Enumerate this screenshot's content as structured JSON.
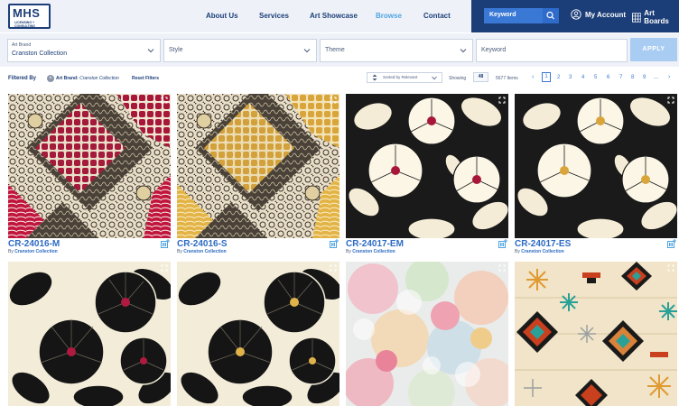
{
  "header": {
    "logo_text": "MHS",
    "logo_sub": "LICENSING + CONSULTING",
    "nav": [
      "About Us",
      "Services",
      "Art Showcase",
      "Browse",
      "Contact"
    ],
    "active_nav": "Browse",
    "keyword_label": "Keyword",
    "account_label": "My Account",
    "boards_label": "Art Boards"
  },
  "filters": {
    "art_brand_label": "Art Brand",
    "art_brand_value": "Cranston Collection",
    "style_placeholder": "Style",
    "theme_placeholder": "Theme",
    "keyword_placeholder": "Keyword",
    "apply_label": "APPLY"
  },
  "filter_row": {
    "filtered_by": "Filtered By",
    "chip_key": "Art Brand:",
    "chip_value": "Cranston Collection",
    "reset": "Reset Filters",
    "sort": "Sorted by Relevant",
    "showing": "Showing",
    "per_page": "48",
    "items": "5677 Items",
    "pages": [
      "1",
      "2",
      "3",
      "4",
      "5",
      "6",
      "7",
      "8",
      "9",
      "..."
    ],
    "current_page": "1"
  },
  "tiles": [
    {
      "code": "CR-24016-M",
      "by": "By",
      "brand": "Cranston Collection",
      "pattern": "patchwork-red"
    },
    {
      "code": "CR-24016-S",
      "by": "By",
      "brand": "Cranston Collection",
      "pattern": "patchwork-gold"
    },
    {
      "code": "CR-24017-EM",
      "by": "By",
      "brand": "Cranston Collection",
      "pattern": "floral-cream-red"
    },
    {
      "code": "CR-24017-ES",
      "by": "By",
      "brand": "Cranston Collection",
      "pattern": "floral-cream-gold"
    },
    {
      "code": "",
      "by": "",
      "brand": "",
      "pattern": "floral-black-red"
    },
    {
      "code": "",
      "by": "",
      "brand": "",
      "pattern": "floral-black-gold"
    },
    {
      "code": "",
      "by": "",
      "brand": "",
      "pattern": "watercolor-floral"
    },
    {
      "code": "",
      "by": "",
      "brand": "",
      "pattern": "southwest-geometric"
    }
  ],
  "colors": {
    "navy": "#1c3e78",
    "accent_blue": "#3a78d6",
    "link_blue": "#2d6bc4",
    "apply_bg": "#a9ccf2"
  }
}
